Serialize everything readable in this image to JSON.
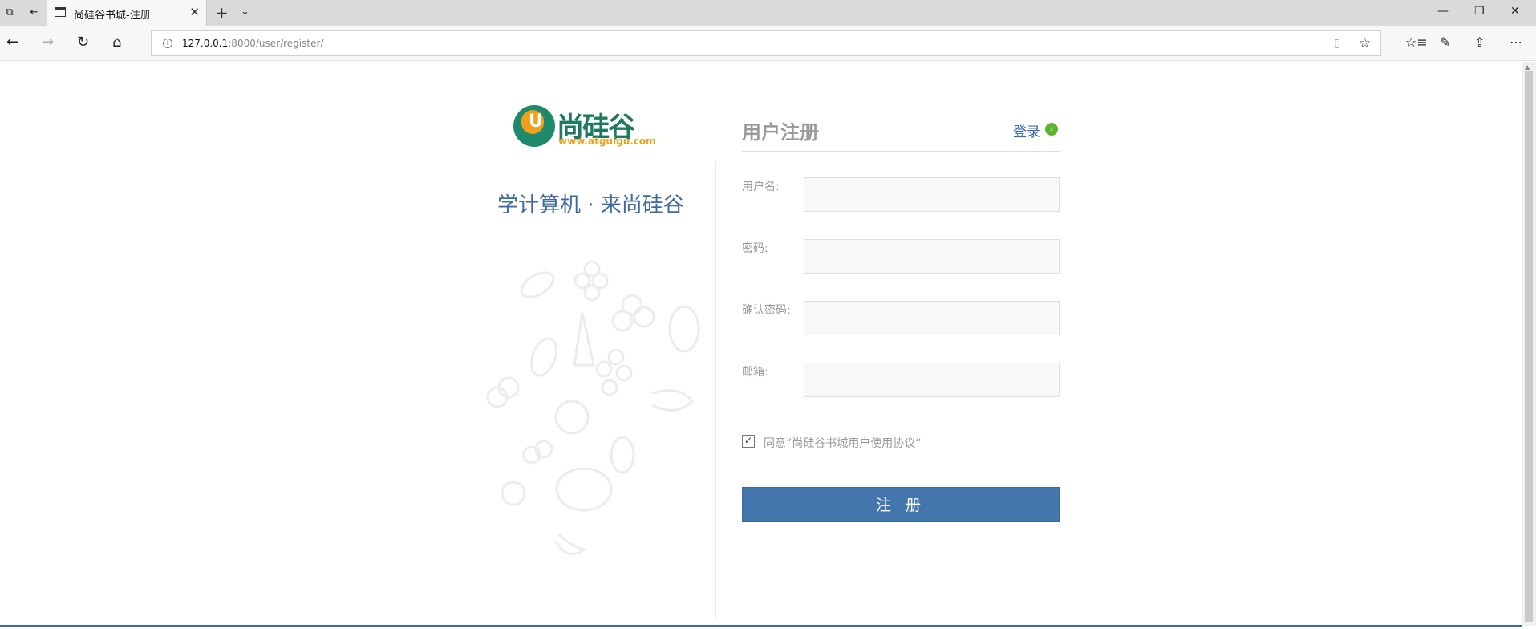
{
  "browser": {
    "tab_title": "尚硅谷书城-注册",
    "url_host": "127.0.0.1",
    "url_path": ":8000/user/register/"
  },
  "logo": {
    "brand": "尚硅谷",
    "site": "www.atguigu.com"
  },
  "slogan": "学计算机 · 来尚硅谷",
  "form": {
    "heading": "用户注册",
    "login_link": "登录",
    "fields": [
      {
        "label": "用户名:",
        "value": ""
      },
      {
        "label": "密码:",
        "value": ""
      },
      {
        "label": "确认密码:",
        "value": ""
      },
      {
        "label": "邮箱:",
        "value": ""
      }
    ],
    "agree_text": "同意”尚硅谷书城用户使用协议“",
    "agree_checked": true,
    "submit_label": "注 册"
  },
  "colors": {
    "accent": "#4276ad",
    "brand_green": "#1e8a6b",
    "brand_orange": "#f2a01c",
    "login_dot": "#5cb531"
  }
}
